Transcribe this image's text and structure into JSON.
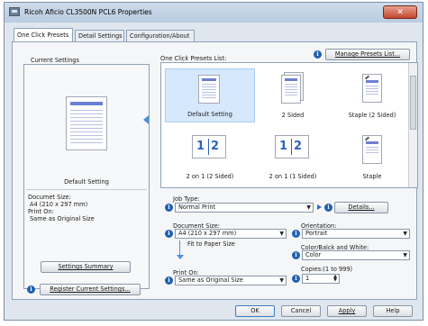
{
  "window": {
    "title": "Ricoh Aficio CL3500N PCL6 Properties",
    "close_glyph": "✕"
  },
  "tabs": [
    "One Click Presets",
    "Detail Settings",
    "Configuration/About"
  ],
  "current_settings": {
    "heading": "Current Settings",
    "preview_name": "Default Setting",
    "doc_size_label": "Documet Size:",
    "doc_size_value": "A4 (210 x 297 mm)",
    "print_on_label": "Print On:",
    "print_on_value": "Same as Original Size",
    "summary_button": "Settings Summary",
    "register_button": "Register Current Settings..."
  },
  "presets": {
    "list_label": "One Click Presets List:",
    "manage_button": "Manage Presets List...",
    "items": [
      {
        "label": "Default Setting",
        "icon": "doc",
        "selected": true
      },
      {
        "label": "2 Sided",
        "icon": "duplex"
      },
      {
        "label": "Staple (2 Sided)",
        "icon": "staple"
      },
      {
        "label": "2 on 1 (2 Sided)",
        "icon": "nup"
      },
      {
        "label": "2 on 1 (1 Sided)",
        "icon": "nup"
      },
      {
        "label": "Staple",
        "icon": "staple"
      }
    ],
    "nup_digits": [
      "1",
      "2"
    ]
  },
  "settings": {
    "job_type_label": "Job Type:",
    "job_type_value": "Normal Print",
    "details_button": "Details...",
    "document_size_label": "Document Size:",
    "document_size_value": "A4 (210 x 297 mm)",
    "fit_label": "Fit to Paper Size",
    "orientation_label": "Orientation:",
    "orientation_value": "Portrait",
    "color_label": "Color/Balck and White:",
    "color_value": "Color",
    "print_on_label": "Print On:",
    "print_on_value": "Same as Original Size",
    "copies_label": "Copies:(1 to 999)",
    "copies_value": "1"
  },
  "footer": {
    "ok": "OK",
    "cancel": "Cancel",
    "apply": "Apply",
    "help": "Help"
  },
  "colors": {
    "accent": "#1f5fb0",
    "selection": "#d6e8fb",
    "doc_header": "#6b7fd1"
  }
}
